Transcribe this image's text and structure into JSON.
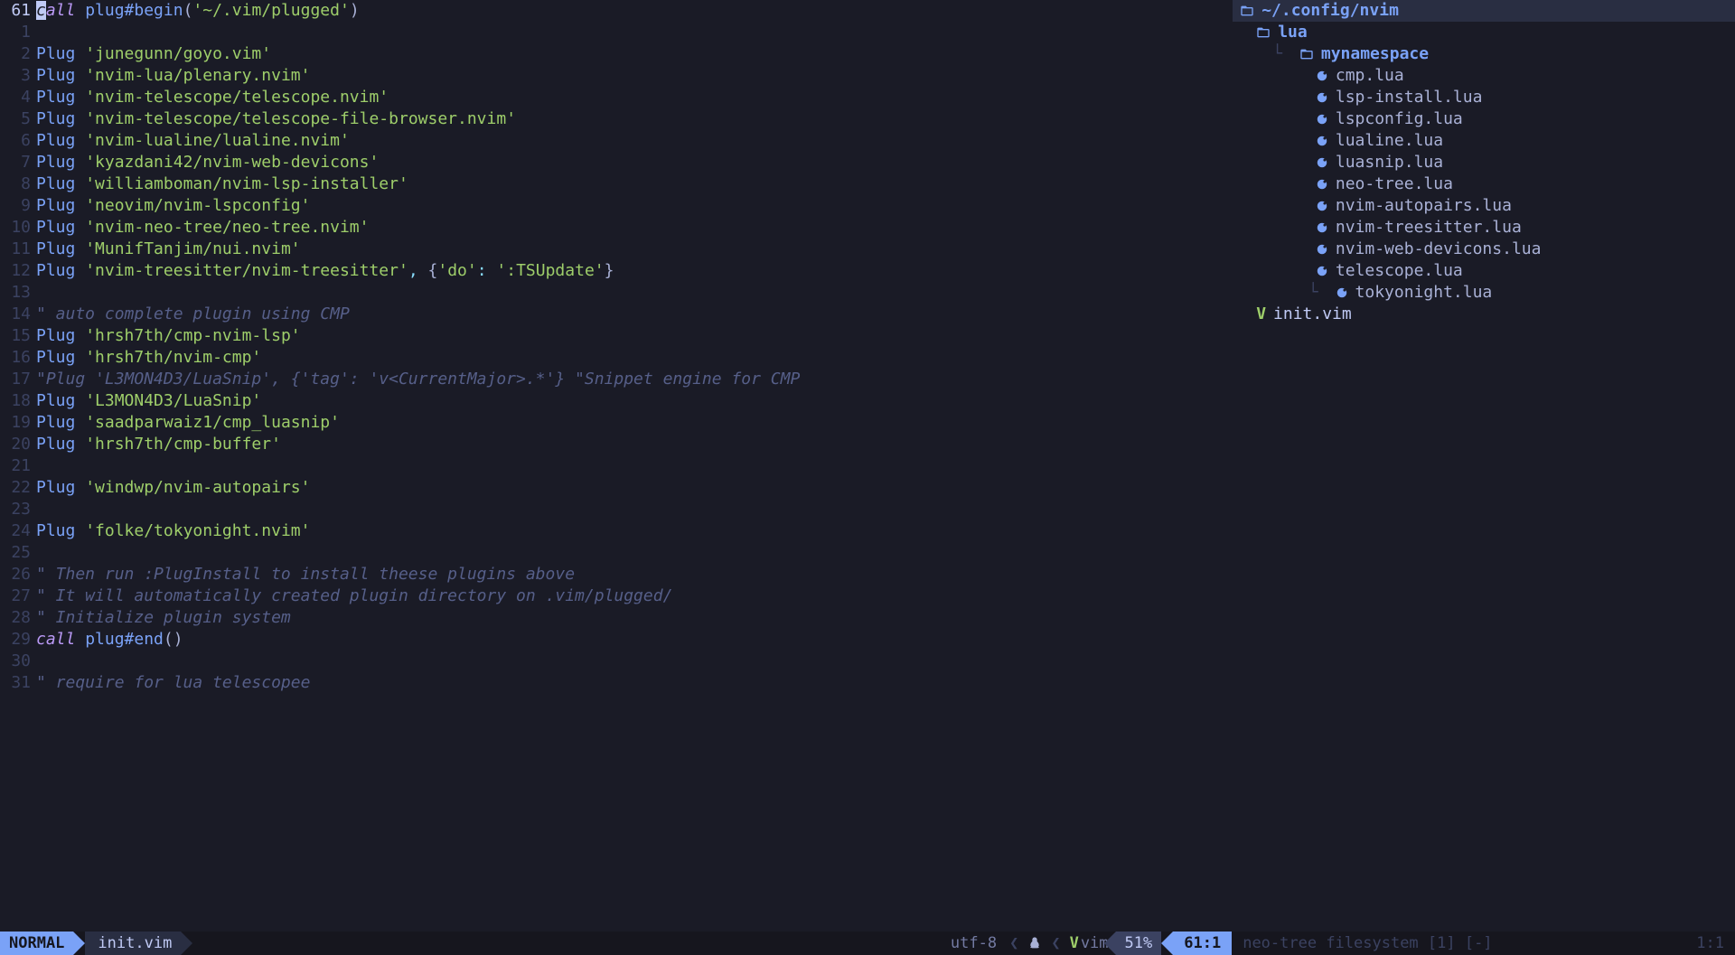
{
  "editor": {
    "current_line_number": "61",
    "lines": [
      {
        "n": "61",
        "current": true,
        "tokens": [
          {
            "t": "cursor",
            "v": "c"
          },
          {
            "t": "kw",
            "v": "all"
          },
          {
            "t": "txt",
            "v": " "
          },
          {
            "t": "func",
            "v": "plug#begin"
          },
          {
            "t": "paren",
            "v": "("
          },
          {
            "t": "str",
            "v": "'~/.vim/plugged'"
          },
          {
            "t": "paren",
            "v": ")"
          }
        ]
      },
      {
        "n": "1",
        "tokens": []
      },
      {
        "n": "2",
        "tokens": [
          {
            "t": "func",
            "v": "Plug"
          },
          {
            "t": "txt",
            "v": " "
          },
          {
            "t": "str",
            "v": "'junegunn/goyo.vim'"
          }
        ]
      },
      {
        "n": "3",
        "tokens": [
          {
            "t": "func",
            "v": "Plug"
          },
          {
            "t": "txt",
            "v": " "
          },
          {
            "t": "str",
            "v": "'nvim-lua/plenary.nvim'"
          }
        ]
      },
      {
        "n": "4",
        "tokens": [
          {
            "t": "func",
            "v": "Plug"
          },
          {
            "t": "txt",
            "v": " "
          },
          {
            "t": "str",
            "v": "'nvim-telescope/telescope.nvim'"
          }
        ]
      },
      {
        "n": "5",
        "tokens": [
          {
            "t": "func",
            "v": "Plug"
          },
          {
            "t": "txt",
            "v": " "
          },
          {
            "t": "str",
            "v": "'nvim-telescope/telescope-file-browser.nvim'"
          }
        ]
      },
      {
        "n": "6",
        "tokens": [
          {
            "t": "func",
            "v": "Plug"
          },
          {
            "t": "txt",
            "v": " "
          },
          {
            "t": "str",
            "v": "'nvim-lualine/lualine.nvim'"
          }
        ]
      },
      {
        "n": "7",
        "tokens": [
          {
            "t": "func",
            "v": "Plug"
          },
          {
            "t": "txt",
            "v": " "
          },
          {
            "t": "str",
            "v": "'kyazdani42/nvim-web-devicons'"
          }
        ]
      },
      {
        "n": "8",
        "tokens": [
          {
            "t": "func",
            "v": "Plug"
          },
          {
            "t": "txt",
            "v": " "
          },
          {
            "t": "str",
            "v": "'williamboman/nvim-lsp-installer'"
          }
        ]
      },
      {
        "n": "9",
        "tokens": [
          {
            "t": "func",
            "v": "Plug"
          },
          {
            "t": "txt",
            "v": " "
          },
          {
            "t": "str",
            "v": "'neovim/nvim-lspconfig'"
          }
        ]
      },
      {
        "n": "10",
        "tokens": [
          {
            "t": "func",
            "v": "Plug"
          },
          {
            "t": "txt",
            "v": " "
          },
          {
            "t": "str",
            "v": "'nvim-neo-tree/neo-tree.nvim'"
          }
        ]
      },
      {
        "n": "11",
        "tokens": [
          {
            "t": "func",
            "v": "Plug"
          },
          {
            "t": "txt",
            "v": " "
          },
          {
            "t": "str",
            "v": "'MunifTanjim/nui.nvim'"
          }
        ]
      },
      {
        "n": "12",
        "tokens": [
          {
            "t": "func",
            "v": "Plug"
          },
          {
            "t": "txt",
            "v": " "
          },
          {
            "t": "str",
            "v": "'nvim-treesitter/nvim-treesitter'"
          },
          {
            "t": "punct",
            "v": ", "
          },
          {
            "t": "brace",
            "v": "{"
          },
          {
            "t": "str",
            "v": "'do'"
          },
          {
            "t": "punct",
            "v": ": "
          },
          {
            "t": "str",
            "v": "':TSUpdate'"
          },
          {
            "t": "brace",
            "v": "}"
          }
        ]
      },
      {
        "n": "13",
        "tokens": []
      },
      {
        "n": "14",
        "tokens": [
          {
            "t": "comment",
            "v": "\" auto complete plugin using CMP"
          }
        ]
      },
      {
        "n": "15",
        "tokens": [
          {
            "t": "func",
            "v": "Plug"
          },
          {
            "t": "txt",
            "v": " "
          },
          {
            "t": "str",
            "v": "'hrsh7th/cmp-nvim-lsp'"
          }
        ]
      },
      {
        "n": "16",
        "tokens": [
          {
            "t": "func",
            "v": "Plug"
          },
          {
            "t": "txt",
            "v": " "
          },
          {
            "t": "str",
            "v": "'hrsh7th/nvim-cmp'"
          }
        ]
      },
      {
        "n": "17",
        "tokens": [
          {
            "t": "comment",
            "v": "\"Plug 'L3MON4D3/LuaSnip', {'tag': 'v<CurrentMajor>.*'} \"Snippet engine for CMP"
          }
        ]
      },
      {
        "n": "18",
        "tokens": [
          {
            "t": "func",
            "v": "Plug"
          },
          {
            "t": "txt",
            "v": " "
          },
          {
            "t": "str",
            "v": "'L3MON4D3/LuaSnip'"
          }
        ]
      },
      {
        "n": "19",
        "tokens": [
          {
            "t": "func",
            "v": "Plug"
          },
          {
            "t": "txt",
            "v": " "
          },
          {
            "t": "str",
            "v": "'saadparwaiz1/cmp_luasnip'"
          }
        ]
      },
      {
        "n": "20",
        "tokens": [
          {
            "t": "func",
            "v": "Plug"
          },
          {
            "t": "txt",
            "v": " "
          },
          {
            "t": "str",
            "v": "'hrsh7th/cmp-buffer'"
          }
        ]
      },
      {
        "n": "21",
        "tokens": []
      },
      {
        "n": "22",
        "tokens": [
          {
            "t": "func",
            "v": "Plug"
          },
          {
            "t": "txt",
            "v": " "
          },
          {
            "t": "str",
            "v": "'windwp/nvim-autopairs'"
          }
        ]
      },
      {
        "n": "23",
        "tokens": []
      },
      {
        "n": "24",
        "tokens": [
          {
            "t": "func",
            "v": "Plug"
          },
          {
            "t": "txt",
            "v": " "
          },
          {
            "t": "str",
            "v": "'folke/tokyonight.nvim'"
          }
        ]
      },
      {
        "n": "25",
        "tokens": []
      },
      {
        "n": "26",
        "tokens": [
          {
            "t": "comment",
            "v": "\" Then run :PlugInstall to install theese plugins above"
          }
        ]
      },
      {
        "n": "27",
        "tokens": [
          {
            "t": "comment",
            "v": "\" It will automatically created plugin directory on .vim/plugged/"
          }
        ]
      },
      {
        "n": "28",
        "tokens": [
          {
            "t": "comment",
            "v": "\" Initialize plugin system"
          }
        ]
      },
      {
        "n": "29",
        "tokens": [
          {
            "t": "kw",
            "v": "call"
          },
          {
            "t": "txt",
            "v": " "
          },
          {
            "t": "func",
            "v": "plug#end"
          },
          {
            "t": "paren",
            "v": "()"
          }
        ]
      },
      {
        "n": "30",
        "tokens": []
      },
      {
        "n": "31",
        "tokens": [
          {
            "t": "comment",
            "v": "\" require for lua telescopee"
          }
        ]
      }
    ]
  },
  "tree": {
    "root_label": "~/.config/nvim",
    "items": [
      {
        "depth": 1,
        "type": "folder",
        "name": "lua",
        "guide": ""
      },
      {
        "depth": 2,
        "type": "folder",
        "name": "mynamespace",
        "guide": "└ "
      },
      {
        "depth": 3,
        "type": "lua",
        "name": "cmp.lua",
        "guide": "  "
      },
      {
        "depth": 3,
        "type": "lua",
        "name": "lsp-install.lua",
        "guide": "  "
      },
      {
        "depth": 3,
        "type": "lua",
        "name": "lspconfig.lua",
        "guide": "  "
      },
      {
        "depth": 3,
        "type": "lua",
        "name": "lualine.lua",
        "guide": "  "
      },
      {
        "depth": 3,
        "type": "lua",
        "name": "luasnip.lua",
        "guide": "  "
      },
      {
        "depth": 3,
        "type": "lua",
        "name": "neo-tree.lua",
        "guide": "  "
      },
      {
        "depth": 3,
        "type": "lua",
        "name": "nvim-autopairs.lua",
        "guide": "  "
      },
      {
        "depth": 3,
        "type": "lua",
        "name": "nvim-treesitter.lua",
        "guide": "  "
      },
      {
        "depth": 3,
        "type": "lua",
        "name": "nvim-web-devicons.lua",
        "guide": "  "
      },
      {
        "depth": 3,
        "type": "lua",
        "name": "telescope.lua",
        "guide": "  "
      },
      {
        "depth": 3,
        "type": "lua",
        "name": "tokyonight.lua",
        "guide": "  └ "
      },
      {
        "depth": 1,
        "type": "vim",
        "name": "init.vim",
        "guide": ""
      }
    ]
  },
  "statusline": {
    "mode": "NORMAL",
    "filename": "init.vim",
    "encoding": "utf-8",
    "filetype": "vim",
    "percent": "51%",
    "position": "61:1",
    "inactive_title": "neo-tree filesystem [1] [-]",
    "inactive_position": "1:1"
  },
  "colors": {
    "bg": "#1a1b26",
    "accent": "#7aa2f7",
    "green": "#9ece6a",
    "purple": "#bb9af7",
    "comment": "#565f89"
  }
}
